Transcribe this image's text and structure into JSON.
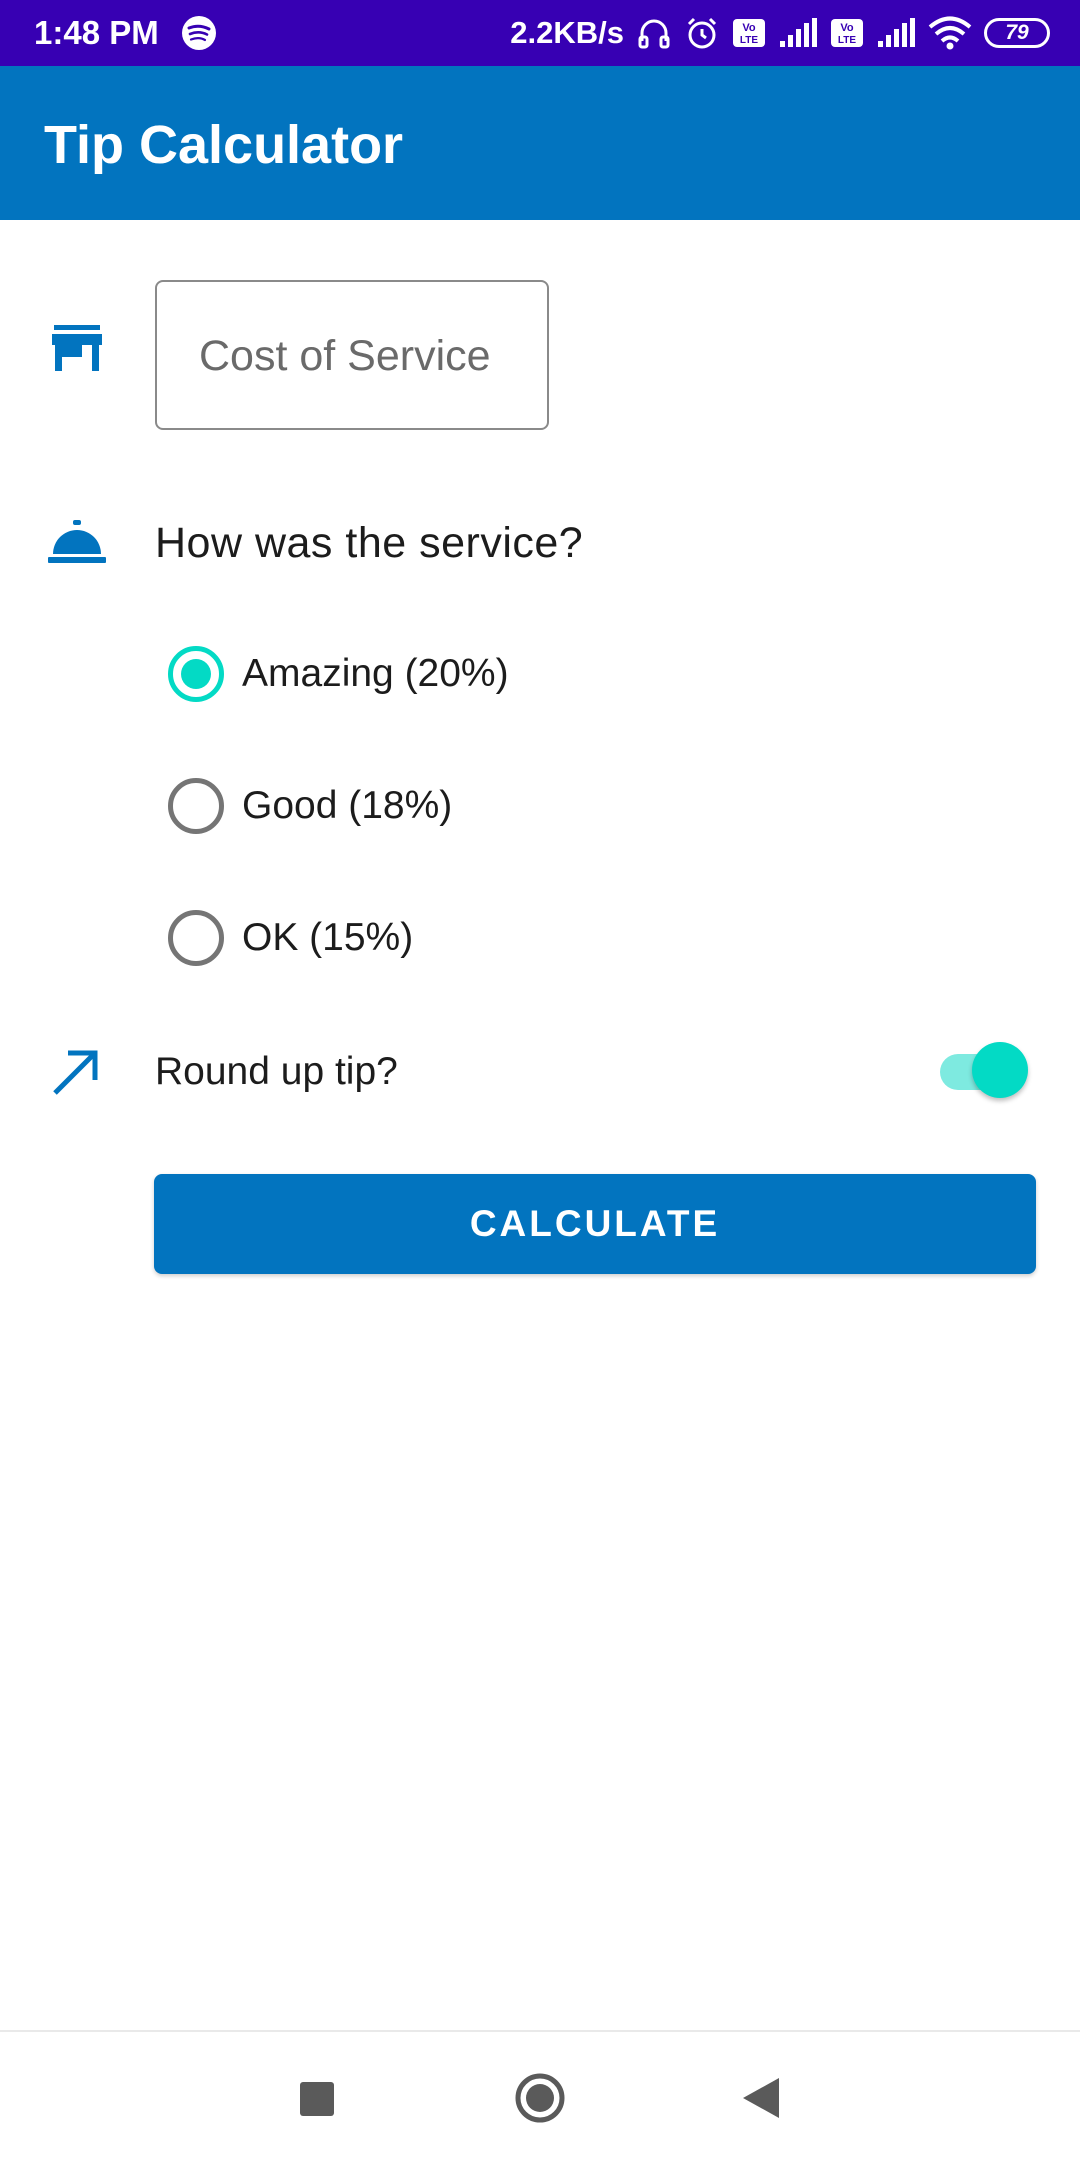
{
  "status_bar": {
    "time": "1:48 PM",
    "net_speed": "2.2KB/s",
    "battery": "79",
    "icons": [
      "spotify-icon",
      "headphones-icon",
      "alarm-icon",
      "volte-icon",
      "signal-icon",
      "volte-icon",
      "signal-icon",
      "wifi-icon",
      "battery-icon"
    ]
  },
  "app_bar": {
    "title": "Tip Calculator"
  },
  "form": {
    "cost_placeholder": "Cost of Service",
    "cost_value": "",
    "service_question": "How was the service?",
    "options": [
      {
        "label": "Amazing (20%)",
        "checked": true
      },
      {
        "label": "Good (18%)",
        "checked": false
      },
      {
        "label": "OK (15%)",
        "checked": false
      }
    ],
    "round_up_label": "Round up tip?",
    "round_up_on": true,
    "calculate_label": "CALCULATE"
  },
  "colors": {
    "status_bar": "#3700b3",
    "primary": "#0274bf",
    "accent": "#03dac5"
  },
  "nav_bar": {
    "icons": [
      "recents-icon",
      "home-icon",
      "back-icon"
    ]
  }
}
